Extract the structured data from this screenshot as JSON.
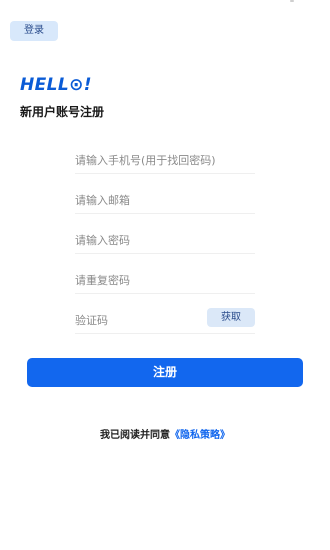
{
  "header": {
    "login_label": "登录"
  },
  "brand": {
    "hello_text": "HELL⊙!",
    "subtitle": "新用户账号注册"
  },
  "form": {
    "phone_placeholder": "请输入手机号(用于找回密码)",
    "email_placeholder": "请输入邮箱",
    "password_placeholder": "请输入密码",
    "confirm_password_placeholder": "请重复密码",
    "code_placeholder": "验证码",
    "get_code_label": "获取",
    "submit_label": "注册"
  },
  "agreement": {
    "prefix": "我已阅读并同意",
    "policy_link": "《隐私策略》"
  },
  "colors": {
    "accent": "#1267ee",
    "brand": "#0a5bd6",
    "button_light": "#d8e8fb"
  }
}
